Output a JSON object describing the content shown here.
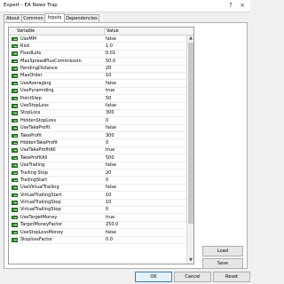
{
  "window": {
    "title": "Expert - EA News Trap",
    "help": "?",
    "close": "×"
  },
  "tabs": [
    {
      "label": "About"
    },
    {
      "label": "Common"
    },
    {
      "label": "Inputs"
    },
    {
      "label": "Dependencies"
    }
  ],
  "grid": {
    "col_variable": "Variable",
    "col_value": "Value",
    "rows": [
      {
        "name": "UseMM",
        "value": "false"
      },
      {
        "name": "Risk",
        "value": "1.0"
      },
      {
        "name": "FixedLots",
        "value": "0.01"
      },
      {
        "name": "MaxSpreadPlusCommission",
        "value": "50.0"
      },
      {
        "name": "PendingDistance",
        "value": "20"
      },
      {
        "name": "MaxOrder",
        "value": "10"
      },
      {
        "name": "UseAveraging",
        "value": "false"
      },
      {
        "name": "UsePyramiding",
        "value": "true"
      },
      {
        "name": "PointStep",
        "value": "50"
      },
      {
        "name": "UseStopLoss",
        "value": "false"
      },
      {
        "name": "StopLoss",
        "value": "300"
      },
      {
        "name": "HiddenStopLoss",
        "value": "0"
      },
      {
        "name": "UseTakeProfit",
        "value": "false"
      },
      {
        "name": "TakeProfit",
        "value": "300"
      },
      {
        "name": "HiddenTakeProfit",
        "value": "0"
      },
      {
        "name": "UseTakeProfitAll",
        "value": "true"
      },
      {
        "name": "TakeProfitAll",
        "value": "500"
      },
      {
        "name": "UseTrailing",
        "value": "false"
      },
      {
        "name": "Trailing Stop",
        "value": "20"
      },
      {
        "name": "TrailingStart",
        "value": "0"
      },
      {
        "name": "UseVirtualTrailing",
        "value": "false"
      },
      {
        "name": "VirtualTrailingStart",
        "value": "10"
      },
      {
        "name": "VirtualTrailingStop",
        "value": "10"
      },
      {
        "name": "VirtualTrailingStop",
        "value": "0"
      },
      {
        "name": "UseTargetMoney",
        "value": "true"
      },
      {
        "name": "TargetMoneyFactor",
        "value": "250.0"
      },
      {
        "name": "UseStopLossMoney",
        "value": "false"
      },
      {
        "name": "StoplossFactor",
        "value": "0.0"
      }
    ]
  },
  "buttons": {
    "load": "Load",
    "save": "Save",
    "ok": "OK",
    "cancel": "Cancel",
    "reset": "Reset"
  }
}
